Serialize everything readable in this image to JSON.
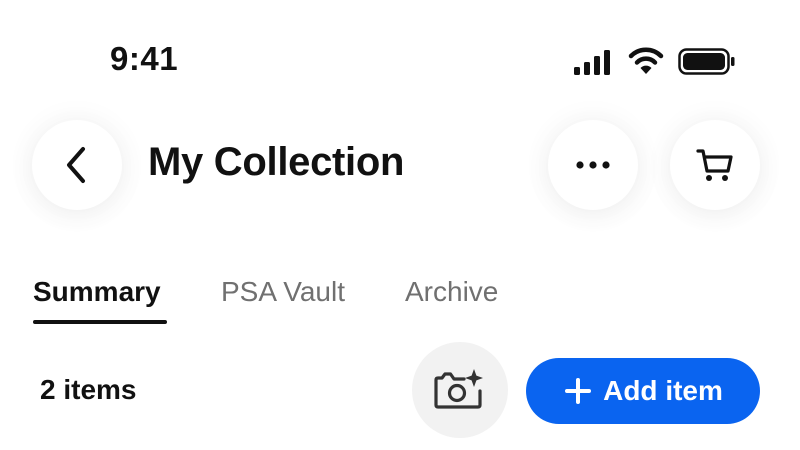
{
  "status_bar": {
    "time": "9:41",
    "icons": [
      "signal-icon",
      "wifi-icon",
      "battery-icon"
    ]
  },
  "header": {
    "title": "My Collection",
    "back_icon": "chevron-left-icon",
    "more_icon": "more-horizontal-icon",
    "cart_icon": "cart-icon"
  },
  "tabs": [
    {
      "label": "Summary",
      "active": true
    },
    {
      "label": "PSA Vault",
      "active": false
    },
    {
      "label": "Archive",
      "active": false
    }
  ],
  "toolbar": {
    "item_count": "2 items",
    "camera_icon": "camera-sparkle-icon",
    "add_label": "Add item"
  },
  "colors": {
    "accent": "#0a64f0",
    "text_primary": "#111111",
    "text_secondary": "#707070",
    "camera_button_bg": "#f2f2f2"
  }
}
